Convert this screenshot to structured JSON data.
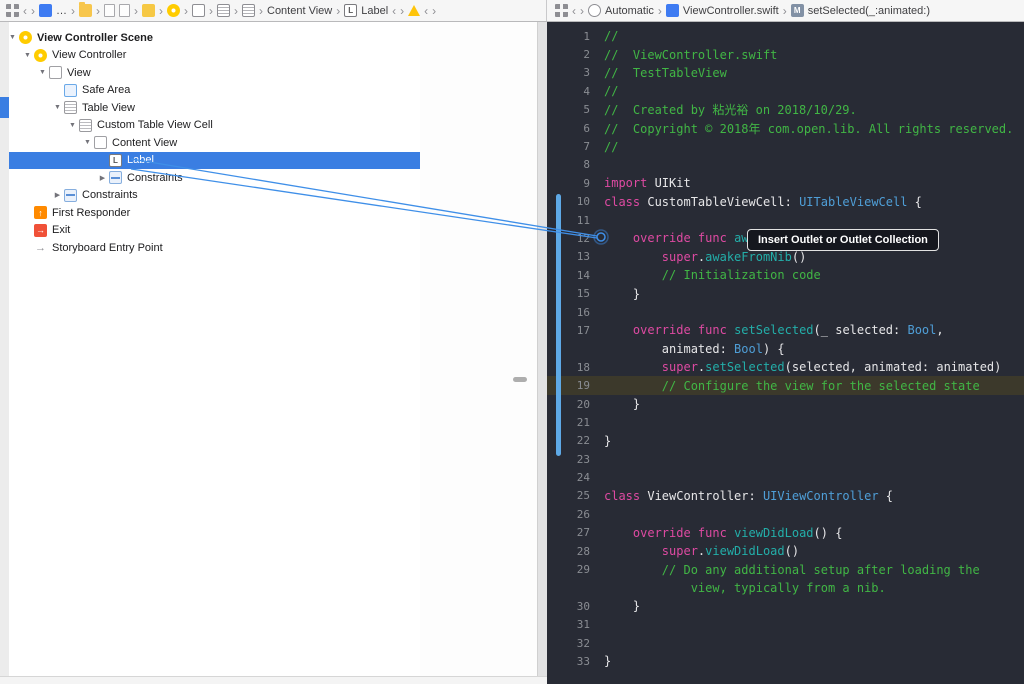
{
  "colors": {
    "selection": "#3A7EE2",
    "editor_bg": "#282B35",
    "line_highlight": "#3C392B",
    "kw": "#DE4AA2",
    "cm": "#41B645",
    "ty": "#4F9FD8",
    "me": "#23AEA9",
    "pl": "#E6E6E8",
    "ln": "#8A8D93",
    "drag_blue": "#5EA9E6",
    "connection_blue": "#3F8FE8",
    "tooltip_bg": "#15171E"
  },
  "tooltip": {
    "text": "Insert Outlet or Outlet Collection"
  },
  "jump_bar_left": {
    "items": [
      {
        "icon": "related"
      },
      {
        "chev": "‹"
      },
      {
        "chev": "›"
      },
      {
        "icon": "project"
      },
      {
        "label": "…"
      },
      {
        "chev": "›"
      },
      {
        "icon": "folder"
      },
      {
        "chev": "›"
      },
      {
        "icon": "doc"
      },
      {
        "icon": "doc"
      },
      {
        "chev": "›"
      },
      {
        "icon": "xib"
      },
      {
        "chev": "›"
      },
      {
        "icon": "vc"
      },
      {
        "chev": "›"
      },
      {
        "icon": "viewsm"
      },
      {
        "chev": "›"
      },
      {
        "icon": "list"
      },
      {
        "chev": "›"
      },
      {
        "icon": "list"
      },
      {
        "chev": "›"
      },
      {
        "label": "Content View"
      },
      {
        "chev": "›"
      },
      {
        "icon": "lbadge"
      },
      {
        "label": "Label"
      },
      {
        "chev": "‹"
      },
      {
        "chev": "›"
      },
      {
        "icon": "warn"
      },
      {
        "chev": "‹"
      },
      {
        "chev": "›"
      }
    ]
  },
  "jump_bar_right": {
    "items": [
      {
        "icon": "related"
      },
      {
        "chev": "‹"
      },
      {
        "chev": "›"
      },
      {
        "icon": "auto"
      },
      {
        "label": "Automatic"
      },
      {
        "chev": "›"
      },
      {
        "icon": "swift"
      },
      {
        "label": "ViewController.swift"
      },
      {
        "chev": "›"
      },
      {
        "icon": "mbadge"
      },
      {
        "label": "setSelected(_:animated:)"
      }
    ]
  },
  "outline": {
    "rows": [
      {
        "label": "View Controller Scene",
        "level": 0,
        "disclosure": "open",
        "icon": "scene",
        "bold": true
      },
      {
        "label": "View Controller",
        "level": 1,
        "disclosure": "open",
        "icon": "vc"
      },
      {
        "label": "View",
        "level": 2,
        "disclosure": "open",
        "icon": "view"
      },
      {
        "label": "Safe Area",
        "level": 3,
        "disclosure": "none",
        "icon": "safearea"
      },
      {
        "label": "Table View",
        "level": 3,
        "disclosure": "open",
        "icon": "tableview"
      },
      {
        "label": "Custom Table View Cell",
        "level": 4,
        "disclosure": "open",
        "icon": "cell"
      },
      {
        "label": "Content View",
        "level": 5,
        "disclosure": "open",
        "icon": "view"
      },
      {
        "label": "Label",
        "level": 6,
        "disclosure": "none",
        "icon": "label",
        "selected": true
      },
      {
        "label": "Constraints",
        "level": 6,
        "disclosure": "closed",
        "icon": "constraints"
      },
      {
        "label": "Constraints",
        "level": 3,
        "disclosure": "closed",
        "icon": "constraints"
      },
      {
        "label": "First Responder",
        "level": 1,
        "disclosure": "none",
        "icon": "firstresponder"
      },
      {
        "label": "Exit",
        "level": 1,
        "disclosure": "none",
        "icon": "exit"
      },
      {
        "label": "Storyboard Entry Point",
        "level": 1,
        "disclosure": "none",
        "icon": "entrypoint"
      }
    ]
  },
  "code": {
    "rows": [
      {
        "n": "1",
        "segs": [
          {
            "t": "//",
            "c": "cm"
          }
        ]
      },
      {
        "n": "2",
        "segs": [
          {
            "t": "//  ViewController.swift",
            "c": "cm"
          }
        ]
      },
      {
        "n": "3",
        "segs": [
          {
            "t": "//  TestTableView",
            "c": "cm"
          }
        ]
      },
      {
        "n": "4",
        "segs": [
          {
            "t": "//",
            "c": "cm"
          }
        ]
      },
      {
        "n": "5",
        "segs": [
          {
            "t": "//  Created by 粘光裕 on 2018/10/29.",
            "c": "cm"
          }
        ]
      },
      {
        "n": "6",
        "segs": [
          {
            "t": "//  Copyright © 2018年 com.open.lib. All rights reserved.",
            "c": "cm"
          }
        ]
      },
      {
        "n": "7",
        "segs": [
          {
            "t": "//",
            "c": "cm"
          }
        ]
      },
      {
        "n": "8",
        "segs": []
      },
      {
        "n": "9",
        "segs": [
          {
            "t": "import",
            "c": "kw"
          },
          {
            "t": " UIKit",
            "c": "pl"
          }
        ]
      },
      {
        "n": "10",
        "segs": [
          {
            "t": "class",
            "c": "kw"
          },
          {
            "t": " CustomTableViewCell: ",
            "c": "pl"
          },
          {
            "t": "UITableViewCell",
            "c": "ty"
          },
          {
            "t": " {",
            "c": "pl"
          }
        ]
      },
      {
        "n": "11",
        "segs": []
      },
      {
        "n": "12",
        "segs": [
          {
            "t": "    ",
            "c": "pl"
          },
          {
            "t": "override func",
            "c": "kw"
          },
          {
            "t": " ",
            "c": "pl"
          },
          {
            "t": "awakeFromNib",
            "c": "me"
          },
          {
            "t": "() {",
            "c": "pl"
          }
        ]
      },
      {
        "n": "13",
        "segs": [
          {
            "t": "        ",
            "c": "pl"
          },
          {
            "t": "super",
            "c": "kw"
          },
          {
            "t": ".",
            "c": "pl"
          },
          {
            "t": "awakeFromNib",
            "c": "me"
          },
          {
            "t": "()",
            "c": "pl"
          }
        ]
      },
      {
        "n": "14",
        "segs": [
          {
            "t": "        ",
            "c": "pl"
          },
          {
            "t": "// Initialization code",
            "c": "cm"
          }
        ]
      },
      {
        "n": "15",
        "segs": [
          {
            "t": "    }",
            "c": "pl"
          }
        ]
      },
      {
        "n": "16",
        "segs": []
      },
      {
        "n": "17",
        "segs": [
          {
            "t": "    ",
            "c": "pl"
          },
          {
            "t": "override func",
            "c": "kw"
          },
          {
            "t": " ",
            "c": "pl"
          },
          {
            "t": "setSelected",
            "c": "me"
          },
          {
            "t": "(_ selected: ",
            "c": "pl"
          },
          {
            "t": "Bool",
            "c": "ty"
          },
          {
            "t": ",",
            "c": "pl"
          }
        ]
      },
      {
        "n": "",
        "segs": [
          {
            "t": "        animated: ",
            "c": "pl"
          },
          {
            "t": "Bool",
            "c": "ty"
          },
          {
            "t": ") {",
            "c": "pl"
          }
        ]
      },
      {
        "n": "18",
        "segs": [
          {
            "t": "        ",
            "c": "pl"
          },
          {
            "t": "super",
            "c": "kw"
          },
          {
            "t": ".",
            "c": "pl"
          },
          {
            "t": "setSelected",
            "c": "me"
          },
          {
            "t": "(selected, animated: animated)",
            "c": "pl"
          }
        ]
      },
      {
        "n": "19",
        "hl": true,
        "segs": [
          {
            "t": "        ",
            "c": "pl"
          },
          {
            "t": "// Configure the view for the selected state",
            "c": "cm"
          }
        ]
      },
      {
        "n": "20",
        "segs": [
          {
            "t": "    }",
            "c": "pl"
          }
        ]
      },
      {
        "n": "21",
        "segs": []
      },
      {
        "n": "22",
        "segs": [
          {
            "t": "}",
            "c": "pl"
          }
        ]
      },
      {
        "n": "23",
        "segs": []
      },
      {
        "n": "24",
        "segs": []
      },
      {
        "n": "25",
        "segs": [
          {
            "t": "class",
            "c": "kw"
          },
          {
            "t": " ViewController: ",
            "c": "pl"
          },
          {
            "t": "UIViewController",
            "c": "ty"
          },
          {
            "t": " {",
            "c": "pl"
          }
        ]
      },
      {
        "n": "26",
        "segs": []
      },
      {
        "n": "27",
        "segs": [
          {
            "t": "    ",
            "c": "pl"
          },
          {
            "t": "override func",
            "c": "kw"
          },
          {
            "t": " ",
            "c": "pl"
          },
          {
            "t": "viewDidLoad",
            "c": "me"
          },
          {
            "t": "() {",
            "c": "pl"
          }
        ]
      },
      {
        "n": "28",
        "segs": [
          {
            "t": "        ",
            "c": "pl"
          },
          {
            "t": "super",
            "c": "kw"
          },
          {
            "t": ".",
            "c": "pl"
          },
          {
            "t": "viewDidLoad",
            "c": "me"
          },
          {
            "t": "()",
            "c": "pl"
          }
        ]
      },
      {
        "n": "29",
        "segs": [
          {
            "t": "        ",
            "c": "pl"
          },
          {
            "t": "// Do any additional setup after loading the",
            "c": "cm"
          }
        ]
      },
      {
        "n": "",
        "segs": [
          {
            "t": "            view, typically from a nib.",
            "c": "cm"
          }
        ]
      },
      {
        "n": "30",
        "segs": [
          {
            "t": "    }",
            "c": "pl"
          }
        ]
      },
      {
        "n": "31",
        "segs": []
      },
      {
        "n": "32",
        "segs": []
      },
      {
        "n": "33",
        "segs": [
          {
            "t": "}",
            "c": "pl"
          }
        ]
      }
    ]
  }
}
